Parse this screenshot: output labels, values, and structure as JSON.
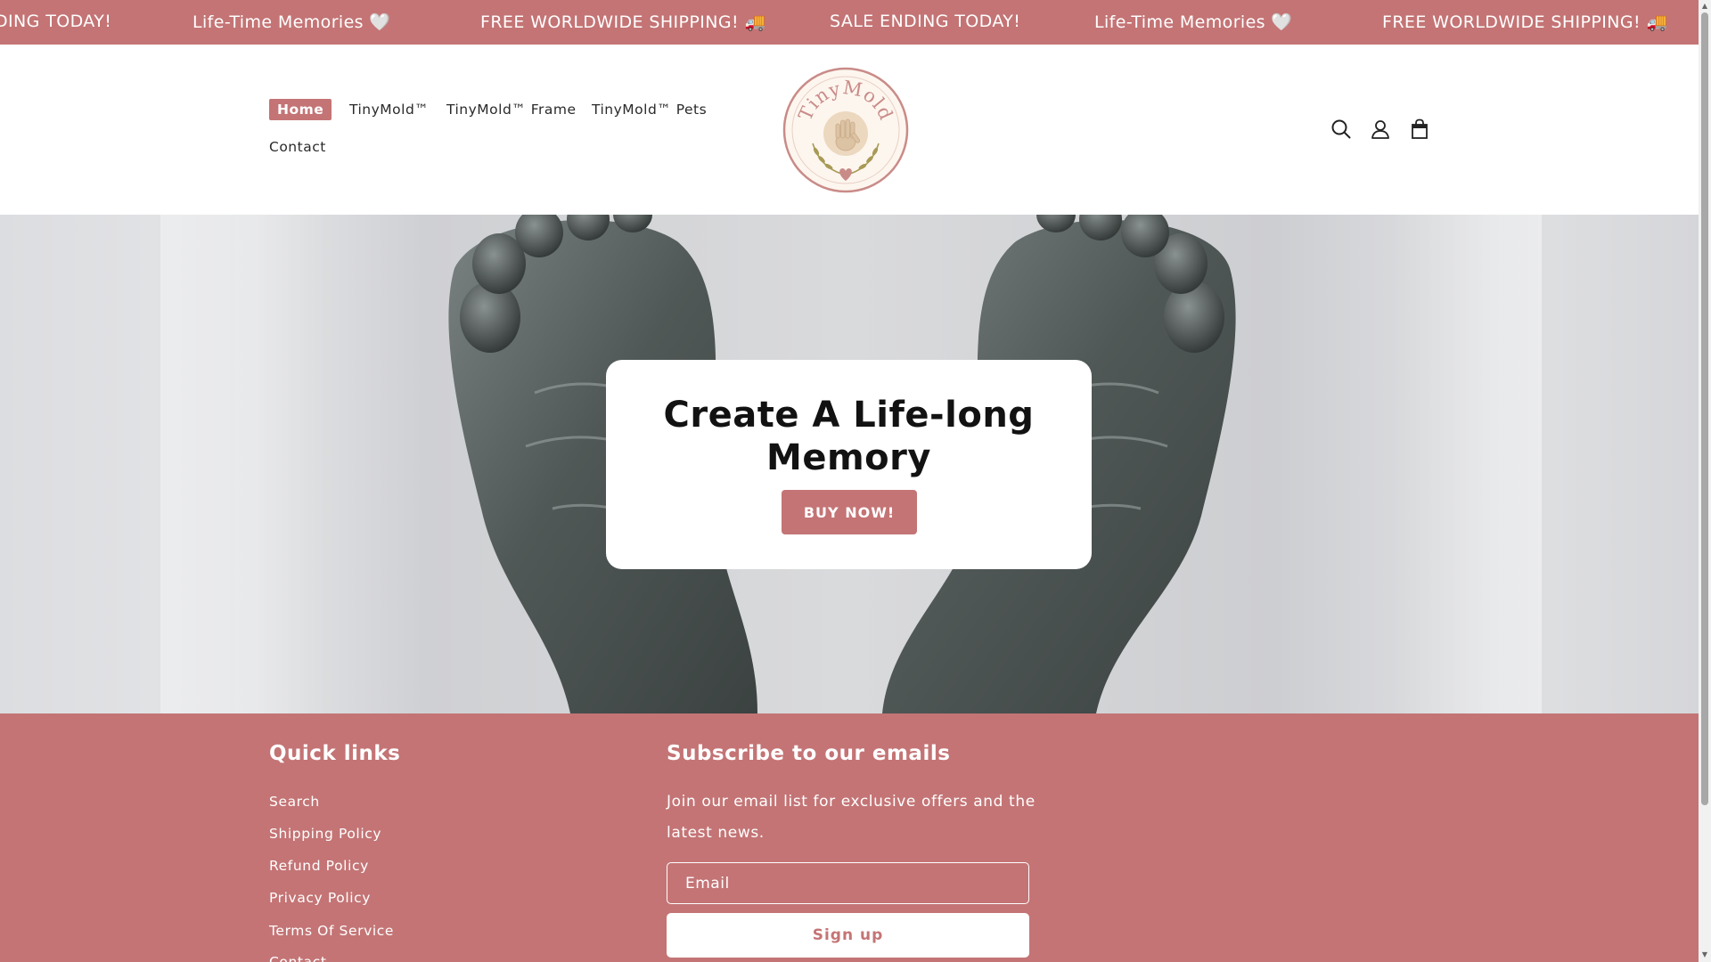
{
  "announcement": {
    "items": [
      "DING TODAY!",
      "Life-Time Memories 🤍",
      "FREE WORLDWIDE SHIPPING! 🚚",
      "SALE ENDING TODAY!",
      "Life-Time Memories 🤍",
      "FREE WORLDWIDE SHIPPING! 🚚"
    ]
  },
  "header": {
    "nav": [
      "Home",
      "TinyMold™",
      "TinyMold™ Frame",
      "TinyMold™ Pets",
      "Contact"
    ],
    "active_nav": "Home",
    "logo_text": "TinyMold",
    "icons": [
      "search-icon",
      "account-icon",
      "cart-icon"
    ]
  },
  "hero": {
    "title": "Create A Life-long Memory",
    "button": "BUY NOW!"
  },
  "footer": {
    "quick_links_heading": "Quick links",
    "links": [
      "Search",
      "Shipping Policy",
      "Refund Policy",
      "Privacy Policy",
      "Terms Of Service",
      "Contact"
    ],
    "subscribe_heading": "Subscribe to our emails",
    "subscribe_text": "Join our email list for exclusive offers and the latest news.",
    "email_placeholder": "Email",
    "signup_button": "Sign up"
  },
  "colors": {
    "brand": "#c47475",
    "white": "#ffffff"
  }
}
